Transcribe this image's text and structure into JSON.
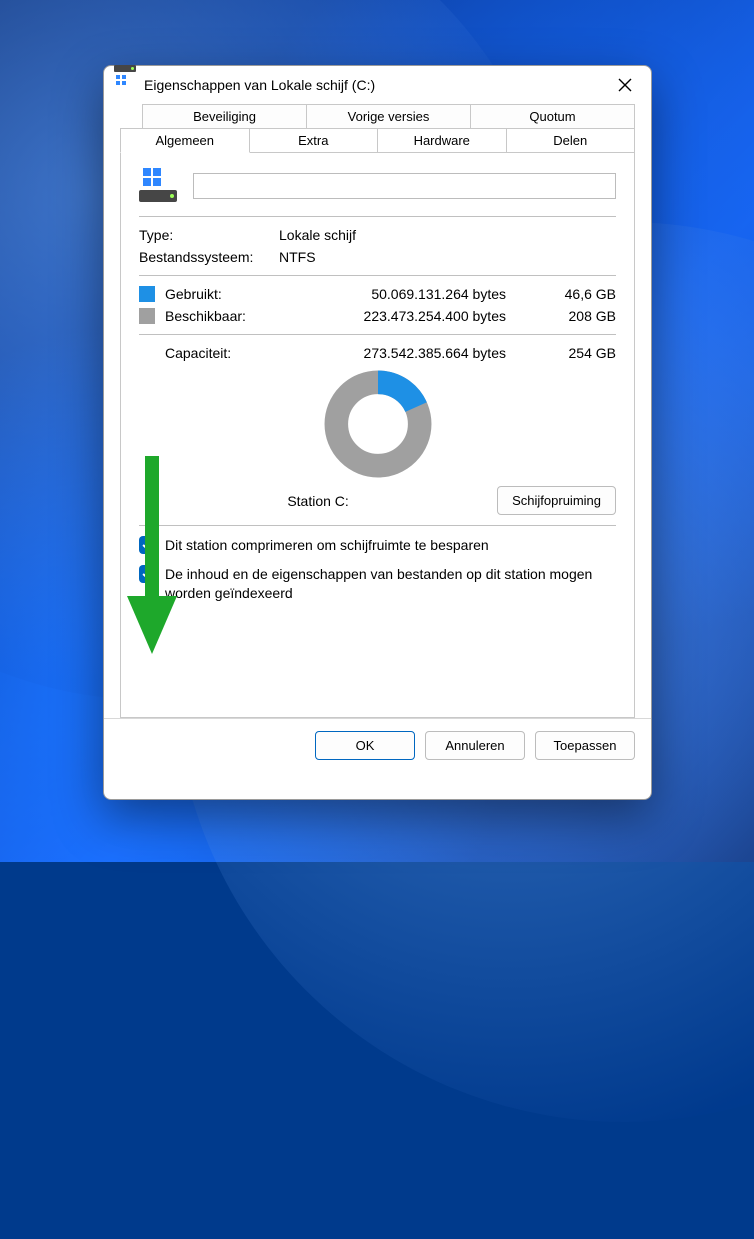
{
  "window": {
    "title": "Eigenschappen van Lokale schijf (C:)"
  },
  "tabs": {
    "row1": [
      "Beveiliging",
      "Vorige versies",
      "Quotum"
    ],
    "row2": [
      "Algemeen",
      "Extra",
      "Hardware",
      "Delen"
    ],
    "active": "Algemeen"
  },
  "general": {
    "name_value": "",
    "type_label": "Type:",
    "type_value": "Lokale schijf",
    "fs_label": "Bestandssysteem:",
    "fs_value": "NTFS",
    "used_label": "Gebruikt:",
    "used_bytes": "50.069.131.264 bytes",
    "used_human": "46,6 GB",
    "free_label": "Beschikbaar:",
    "free_bytes": "223.473.254.400 bytes",
    "free_human": "208 GB",
    "cap_label": "Capaciteit:",
    "cap_bytes": "273.542.385.664 bytes",
    "cap_human": "254 GB",
    "station_label": "Station C:",
    "cleanup_button": "Schijfopruiming",
    "checkbox_compress": "Dit station comprimeren om schijfruimte te besparen",
    "checkbox_index": "De inhoud en de eigenschappen van bestanden op dit station mogen worden geïndexeerd"
  },
  "buttons": {
    "ok": "OK",
    "cancel": "Annuleren",
    "apply": "Toepassen"
  },
  "colors": {
    "used": "#1e90e5",
    "free": "#a0a0a0",
    "accent": "#0067c0"
  },
  "chart_data": {
    "type": "pie",
    "title": "Station C:",
    "series": [
      {
        "name": "Gebruikt",
        "value": 50069131264,
        "human": "46,6 GB",
        "color": "#1e90e5"
      },
      {
        "name": "Beschikbaar",
        "value": 223473254400,
        "human": "208 GB",
        "color": "#a0a0a0"
      }
    ],
    "total": {
      "name": "Capaciteit",
      "value": 273542385664,
      "human": "254 GB"
    }
  }
}
